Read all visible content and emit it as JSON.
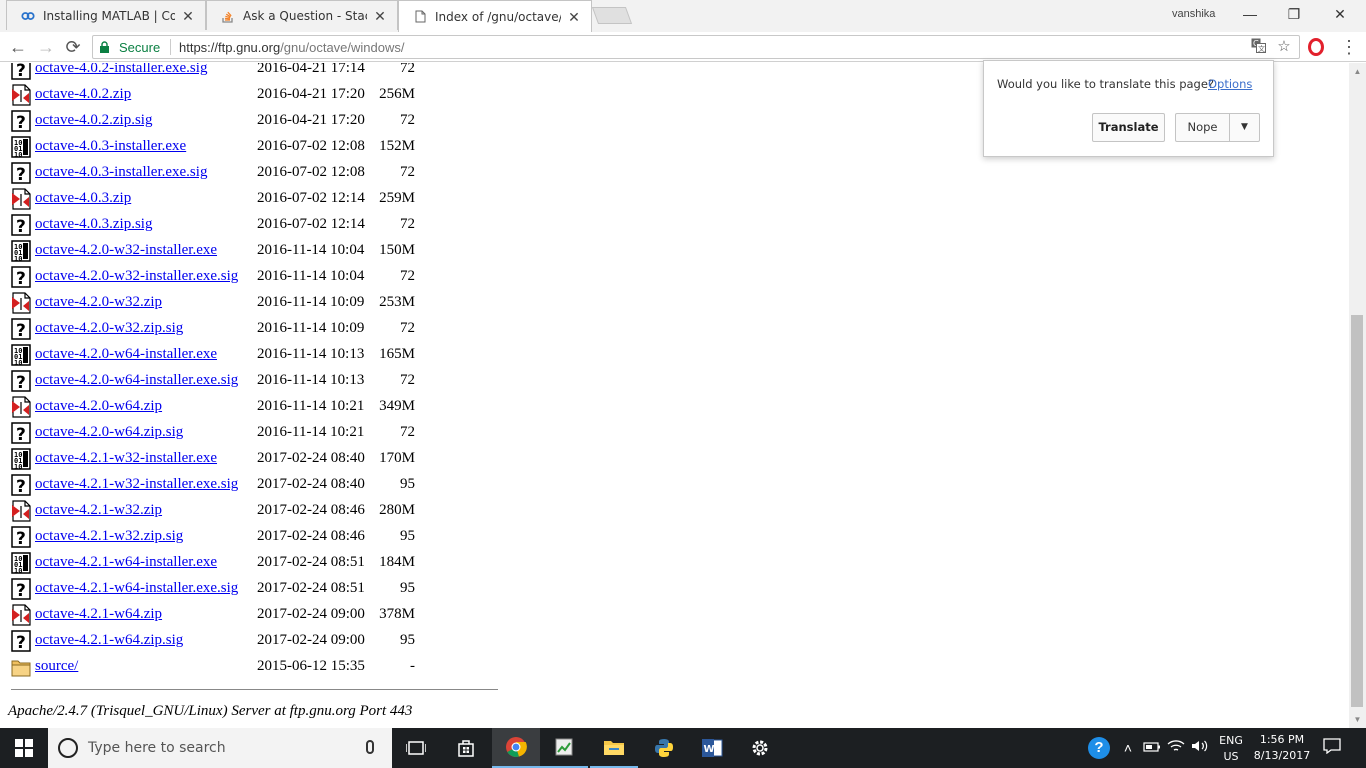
{
  "browser": {
    "tabs": [
      {
        "title": "Installing MATLAB | Cour",
        "icon": "coursera-icon"
      },
      {
        "title": "Ask a Question - Stack O",
        "icon": "stackoverflow-icon"
      },
      {
        "title": "Index of /gnu/octave/win",
        "icon": "page-icon"
      }
    ],
    "username": "vanshika",
    "secure_label": "Secure",
    "url_host": "https://ftp.gnu.org",
    "url_path": "/gnu/octave/windows/"
  },
  "listing": {
    "rows": [
      {
        "name": "octave-4.0.2-installer.exe.sig",
        "date": "2016-04-21 17:14",
        "size": "72",
        "type": "unknown"
      },
      {
        "name": "octave-4.0.2.zip",
        "date": "2016-04-21 17:20",
        "size": "256M",
        "type": "compressed"
      },
      {
        "name": "octave-4.0.2.zip.sig",
        "date": "2016-04-21 17:20",
        "size": "72",
        "type": "unknown"
      },
      {
        "name": "octave-4.0.3-installer.exe",
        "date": "2016-07-02 12:08",
        "size": "152M",
        "type": "binary"
      },
      {
        "name": "octave-4.0.3-installer.exe.sig",
        "date": "2016-07-02 12:08",
        "size": "72",
        "type": "unknown"
      },
      {
        "name": "octave-4.0.3.zip",
        "date": "2016-07-02 12:14",
        "size": "259M",
        "type": "compressed"
      },
      {
        "name": "octave-4.0.3.zip.sig",
        "date": "2016-07-02 12:14",
        "size": "72",
        "type": "unknown"
      },
      {
        "name": "octave-4.2.0-w32-installer.exe",
        "date": "2016-11-14 10:04",
        "size": "150M",
        "type": "binary"
      },
      {
        "name": "octave-4.2.0-w32-installer.exe.sig",
        "date": "2016-11-14 10:04",
        "size": "72",
        "type": "unknown"
      },
      {
        "name": "octave-4.2.0-w32.zip",
        "date": "2016-11-14 10:09",
        "size": "253M",
        "type": "compressed"
      },
      {
        "name": "octave-4.2.0-w32.zip.sig",
        "date": "2016-11-14 10:09",
        "size": "72",
        "type": "unknown"
      },
      {
        "name": "octave-4.2.0-w64-installer.exe",
        "date": "2016-11-14 10:13",
        "size": "165M",
        "type": "binary"
      },
      {
        "name": "octave-4.2.0-w64-installer.exe.sig",
        "date": "2016-11-14 10:13",
        "size": "72",
        "type": "unknown"
      },
      {
        "name": "octave-4.2.0-w64.zip",
        "date": "2016-11-14 10:21",
        "size": "349M",
        "type": "compressed"
      },
      {
        "name": "octave-4.2.0-w64.zip.sig",
        "date": "2016-11-14 10:21",
        "size": "72",
        "type": "unknown"
      },
      {
        "name": "octave-4.2.1-w32-installer.exe",
        "date": "2017-02-24 08:40",
        "size": "170M",
        "type": "binary"
      },
      {
        "name": "octave-4.2.1-w32-installer.exe.sig",
        "date": "2017-02-24 08:40",
        "size": "95",
        "type": "unknown"
      },
      {
        "name": "octave-4.2.1-w32.zip",
        "date": "2017-02-24 08:46",
        "size": "280M",
        "type": "compressed"
      },
      {
        "name": "octave-4.2.1-w32.zip.sig",
        "date": "2017-02-24 08:46",
        "size": "95",
        "type": "unknown"
      },
      {
        "name": "octave-4.2.1-w64-installer.exe",
        "date": "2017-02-24 08:51",
        "size": "184M",
        "type": "binary"
      },
      {
        "name": "octave-4.2.1-w64-installer.exe.sig",
        "date": "2017-02-24 08:51",
        "size": "95",
        "type": "unknown"
      },
      {
        "name": "octave-4.2.1-w64.zip",
        "date": "2017-02-24 09:00",
        "size": "378M",
        "type": "compressed"
      },
      {
        "name": "octave-4.2.1-w64.zip.sig",
        "date": "2017-02-24 09:00",
        "size": "95",
        "type": "unknown"
      },
      {
        "name": "source/",
        "date": "2015-06-12 15:35",
        "size": "-",
        "type": "folder"
      }
    ],
    "address": "Apache/2.4.7 (Trisquel_GNU/Linux) Server at ftp.gnu.org Port 443"
  },
  "translate_bubble": {
    "question": "Would you like to translate this page?",
    "options_label": "Options",
    "translate_label": "Translate",
    "nope_label": "Nope"
  },
  "taskbar": {
    "search_placeholder": "Type here to search",
    "lang_top": "ENG",
    "lang_bottom": "US",
    "time": "1:56 PM",
    "date": "8/13/2017"
  },
  "colors": {
    "link": "#0000ee",
    "secure": "#0b8043",
    "taskbar": "#1c1f22"
  }
}
